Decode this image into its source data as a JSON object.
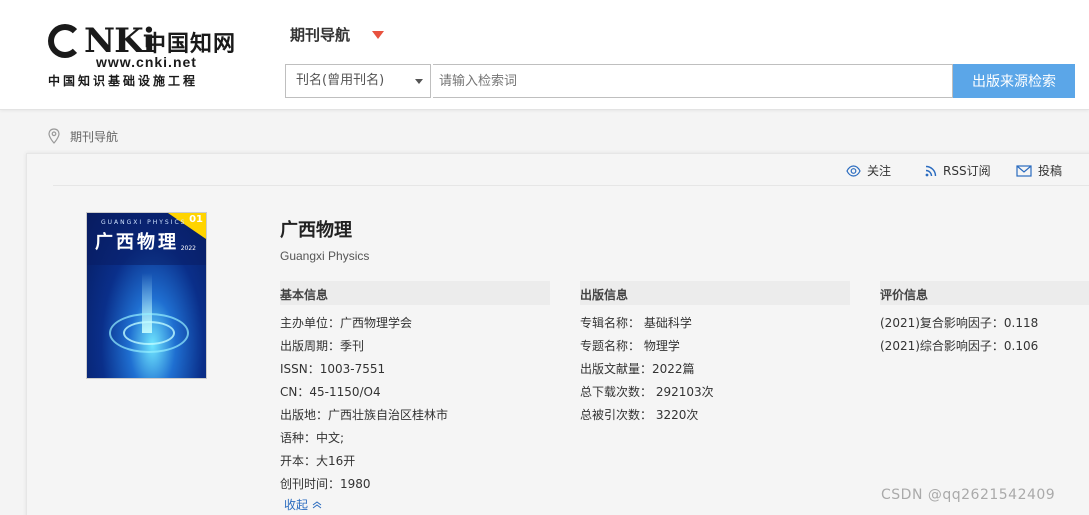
{
  "logo": {
    "brand": "NKi",
    "brand_cn": "中国知网",
    "url": "www.cnki.net",
    "subtitle": "中国知识基础设施工程"
  },
  "header": {
    "nav_title": "期刊导航",
    "search_select": "刊名(曾用刊名)",
    "search_placeholder": "请输入检索词",
    "search_button": "出版来源检索"
  },
  "breadcrumb": "期刊导航",
  "toolbar": {
    "follow": "关注",
    "rss": "RSS订阅",
    "submit": "投稿"
  },
  "cover": {
    "en": "GUANGXI  PHYSICS",
    "cn": "广西物理",
    "issue": "01",
    "year": "2022"
  },
  "journal": {
    "title": "广西物理",
    "title_en": "Guangxi Physics"
  },
  "basic_info": {
    "heading": "基本信息",
    "rows": [
      "主办单位：广西物理学会",
      "出版周期：季刊",
      "ISSN：1003-7551",
      "CN：45-1150/O4",
      "出版地：广西壮族自治区桂林市",
      "语种：中文;",
      "开本：大16开",
      "创刊时间：1980"
    ],
    "collapse_label": "收起"
  },
  "publish_info": {
    "heading": "出版信息",
    "rows": [
      "专辑名称：  基础科学",
      "专题名称：  物理学",
      "出版文献量：2022篇",
      "总下载次数：  292103次",
      "总被引次数：  3220次"
    ]
  },
  "evaluation_info": {
    "heading": "评价信息",
    "rows": [
      "(2021)复合影响因子：0.118",
      "(2021)综合影响因子：0.106"
    ]
  },
  "watermark": "CSDN @qq2621542409",
  "colors": {
    "search_button": "#5ba6e8",
    "accent_arrow": "#e8523f",
    "link": "#2a6bbf"
  }
}
